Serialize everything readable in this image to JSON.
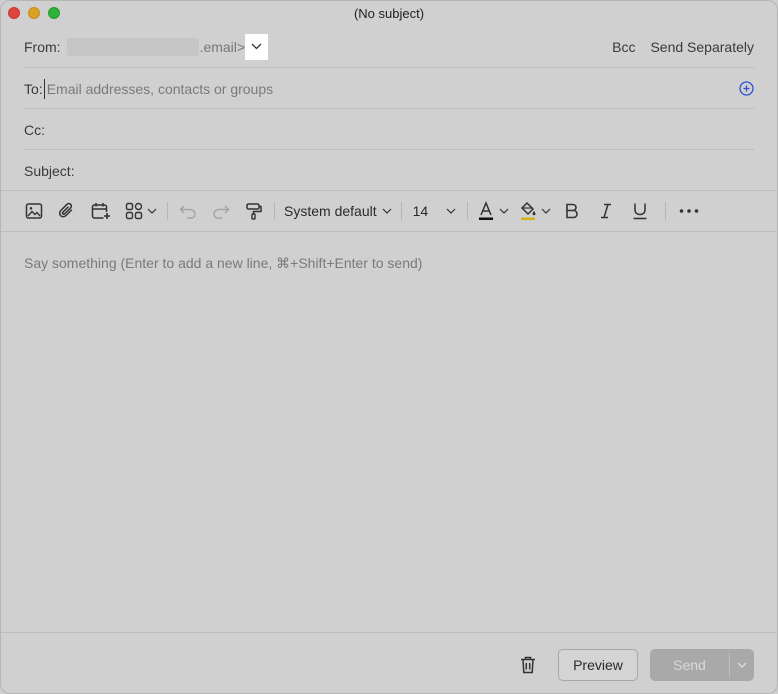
{
  "window": {
    "title": "(No subject)"
  },
  "header": {
    "from_label": "From:",
    "from_suffix": ".email>",
    "bcc_label": "Bcc",
    "send_separately_label": "Send Separately",
    "to_label": "To:",
    "to_placeholder": "Email addresses, contacts or groups",
    "cc_label": "Cc:",
    "subject_label": "Subject:"
  },
  "toolbar": {
    "font_family": "System default",
    "font_size": "14",
    "text_color": "#111111",
    "highlight_color": "#d4b21a",
    "icons": [
      "image-icon",
      "attachment-icon",
      "calendar-add-icon",
      "apps-icon",
      "undo-icon",
      "redo-icon",
      "format-painter-icon",
      "text-color-icon",
      "highlight-icon",
      "bold-icon",
      "italic-icon",
      "underline-icon",
      "more-icon"
    ]
  },
  "body": {
    "placeholder": "Say something (Enter to add a new line, ⌘+Shift+Enter to send)"
  },
  "footer": {
    "preview_label": "Preview",
    "send_label": "Send"
  },
  "colors": {
    "accent": "#2f4fd6",
    "send_disabled": "#a9a9a9"
  }
}
